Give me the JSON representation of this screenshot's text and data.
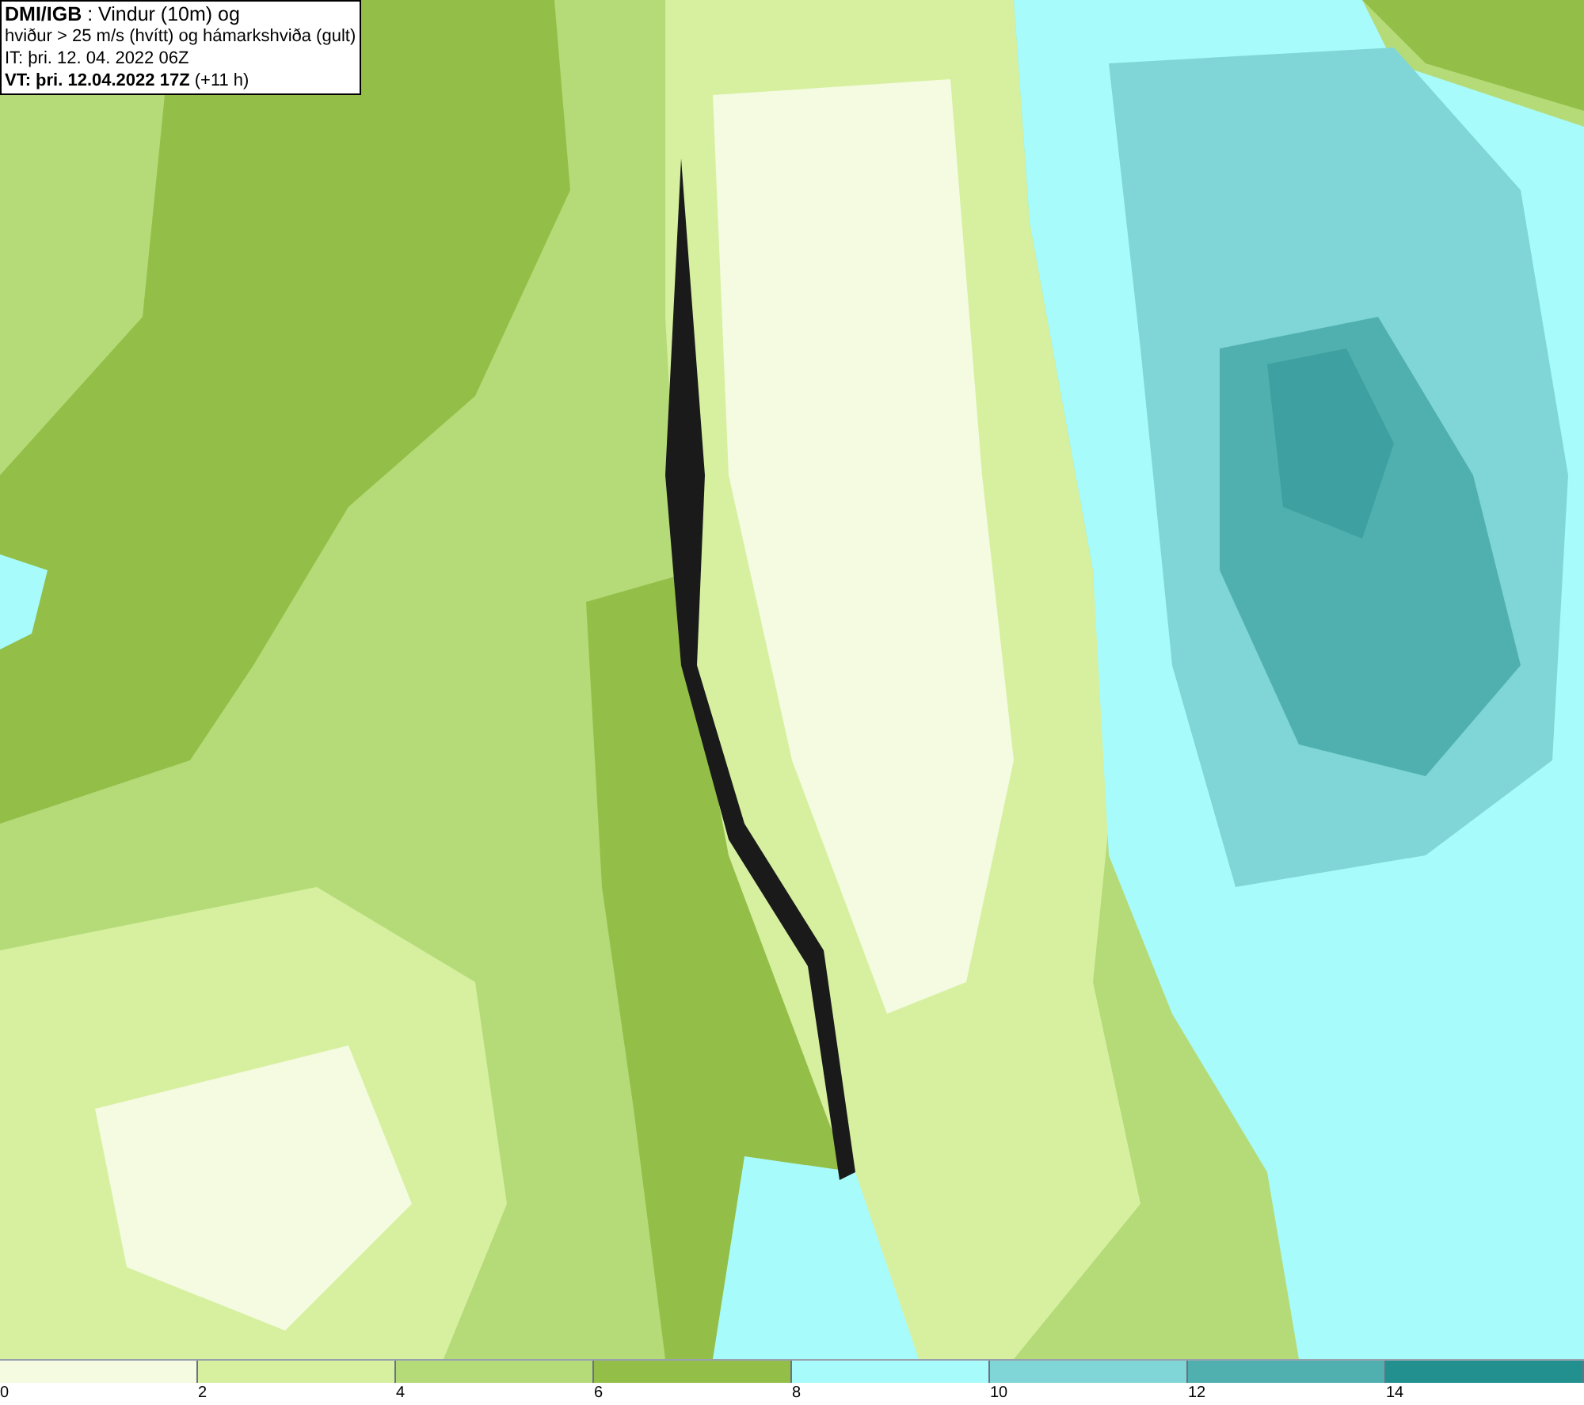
{
  "info_box": {
    "lines": [
      "**DMI/IGB** : Vindur (10m) og",
      "hviður > 25 m/s (hvítt) og hámarkshviða (gult)",
      "IT: þri. 12. 04. 2022 06Z",
      "**VT: þri. 12.04.2022 17Z** (+11 h)"
    ]
  },
  "legend": {
    "segments": [
      {
        "label": "0",
        "color": "#f4fbe0"
      },
      {
        "label": "2",
        "color": "#d6f0a0"
      },
      {
        "label": "4",
        "color": "#b5db78"
      },
      {
        "label": "6",
        "color": "#93bf48"
      },
      {
        "label": "8",
        "color": "#a8fbfb"
      },
      {
        "label": "10",
        "color": "#80d6d6"
      },
      {
        "label": "12",
        "color": "#50b0b0"
      },
      {
        "label": "14",
        "color": "#239090"
      }
    ]
  }
}
